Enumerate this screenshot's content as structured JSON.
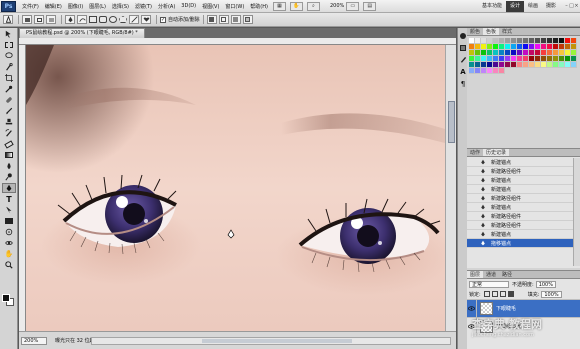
{
  "menubar": {
    "logo": "Ps",
    "items": [
      "文件(F)",
      "编辑(E)",
      "图像(I)",
      "图层(L)",
      "选择(S)",
      "滤镜(T)",
      "分析(A)",
      "3D(D)",
      "视图(V)",
      "窗口(W)",
      "帮助(H)"
    ],
    "zoom": "200%",
    "workspaces": [
      "基本功能",
      "设计",
      "绘画",
      "摄影"
    ],
    "active_workspace": "设计"
  },
  "options_bar": {
    "auto_add_delete_label": "自动添加/删除",
    "auto_add_delete_checked": true
  },
  "document": {
    "tab_title": "PS鼠绘教程.psd @ 200% (下眼睫毛, RGB/8#) *",
    "status_zoom": "200%",
    "status_info": "曝光只在 32 位起作用"
  },
  "swatches_panel": {
    "tabs": [
      "颜色",
      "色板",
      "样式"
    ],
    "active_tab": "色板"
  },
  "history_panel": {
    "tabs": [
      "动作",
      "历史记录"
    ],
    "active_tab": "历史记录",
    "items": [
      {
        "label": "新建锚点",
        "selected": false
      },
      {
        "label": "新建路径组件",
        "selected": false
      },
      {
        "label": "新建锚点",
        "selected": false
      },
      {
        "label": "新建锚点",
        "selected": false
      },
      {
        "label": "新建路径组件",
        "selected": false
      },
      {
        "label": "新建锚点",
        "selected": false
      },
      {
        "label": "新建路径组件",
        "selected": false
      },
      {
        "label": "新建路径组件",
        "selected": false
      },
      {
        "label": "新建锚点",
        "selected": false
      },
      {
        "label": "拖移锚点",
        "selected": true
      }
    ]
  },
  "layers_panel": {
    "tabs": [
      "图层",
      "通道",
      "路径"
    ],
    "blend_mode": "正常",
    "opacity_label": "不透明度:",
    "opacity": "100%",
    "lock_label": "锁定:",
    "fill_label": "填充:",
    "fill": "100%",
    "layers": [
      {
        "name": "下眼睫毛",
        "selected": true
      },
      {
        "name": "下眼线高光",
        "selected": false
      }
    ]
  },
  "watermark": {
    "text": "查字典 教程网",
    "url": "jiaocheng.chazidian.com"
  },
  "colors": {
    "selection": "#2e62bd",
    "workspace_active": "#3a3a3a",
    "panel_bg": "#d4d4d4"
  }
}
